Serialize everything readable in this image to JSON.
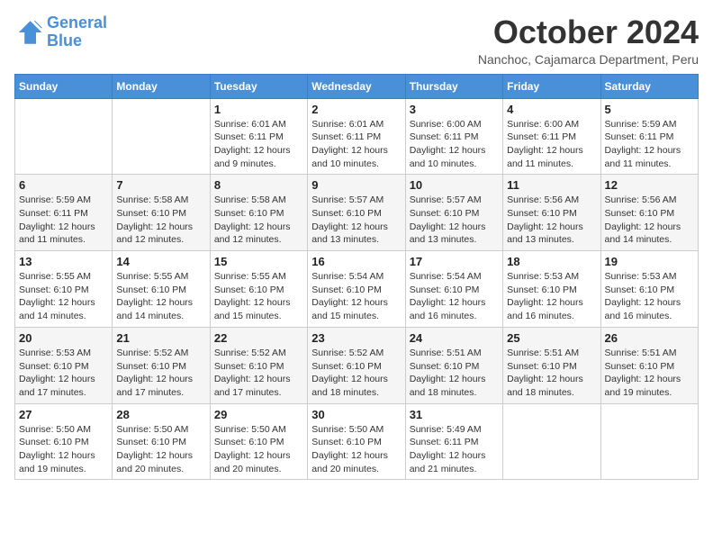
{
  "header": {
    "logo_line1": "General",
    "logo_line2": "Blue",
    "month_title": "October 2024",
    "subtitle": "Nanchoc, Cajamarca Department, Peru"
  },
  "days_of_week": [
    "Sunday",
    "Monday",
    "Tuesday",
    "Wednesday",
    "Thursday",
    "Friday",
    "Saturday"
  ],
  "weeks": [
    [
      {
        "day": "",
        "info": ""
      },
      {
        "day": "",
        "info": ""
      },
      {
        "day": "1",
        "info": "Sunrise: 6:01 AM\nSunset: 6:11 PM\nDaylight: 12 hours and 9 minutes."
      },
      {
        "day": "2",
        "info": "Sunrise: 6:01 AM\nSunset: 6:11 PM\nDaylight: 12 hours and 10 minutes."
      },
      {
        "day": "3",
        "info": "Sunrise: 6:00 AM\nSunset: 6:11 PM\nDaylight: 12 hours and 10 minutes."
      },
      {
        "day": "4",
        "info": "Sunrise: 6:00 AM\nSunset: 6:11 PM\nDaylight: 12 hours and 11 minutes."
      },
      {
        "day": "5",
        "info": "Sunrise: 5:59 AM\nSunset: 6:11 PM\nDaylight: 12 hours and 11 minutes."
      }
    ],
    [
      {
        "day": "6",
        "info": "Sunrise: 5:59 AM\nSunset: 6:11 PM\nDaylight: 12 hours and 11 minutes."
      },
      {
        "day": "7",
        "info": "Sunrise: 5:58 AM\nSunset: 6:10 PM\nDaylight: 12 hours and 12 minutes."
      },
      {
        "day": "8",
        "info": "Sunrise: 5:58 AM\nSunset: 6:10 PM\nDaylight: 12 hours and 12 minutes."
      },
      {
        "day": "9",
        "info": "Sunrise: 5:57 AM\nSunset: 6:10 PM\nDaylight: 12 hours and 13 minutes."
      },
      {
        "day": "10",
        "info": "Sunrise: 5:57 AM\nSunset: 6:10 PM\nDaylight: 12 hours and 13 minutes."
      },
      {
        "day": "11",
        "info": "Sunrise: 5:56 AM\nSunset: 6:10 PM\nDaylight: 12 hours and 13 minutes."
      },
      {
        "day": "12",
        "info": "Sunrise: 5:56 AM\nSunset: 6:10 PM\nDaylight: 12 hours and 14 minutes."
      }
    ],
    [
      {
        "day": "13",
        "info": "Sunrise: 5:55 AM\nSunset: 6:10 PM\nDaylight: 12 hours and 14 minutes."
      },
      {
        "day": "14",
        "info": "Sunrise: 5:55 AM\nSunset: 6:10 PM\nDaylight: 12 hours and 14 minutes."
      },
      {
        "day": "15",
        "info": "Sunrise: 5:55 AM\nSunset: 6:10 PM\nDaylight: 12 hours and 15 minutes."
      },
      {
        "day": "16",
        "info": "Sunrise: 5:54 AM\nSunset: 6:10 PM\nDaylight: 12 hours and 15 minutes."
      },
      {
        "day": "17",
        "info": "Sunrise: 5:54 AM\nSunset: 6:10 PM\nDaylight: 12 hours and 16 minutes."
      },
      {
        "day": "18",
        "info": "Sunrise: 5:53 AM\nSunset: 6:10 PM\nDaylight: 12 hours and 16 minutes."
      },
      {
        "day": "19",
        "info": "Sunrise: 5:53 AM\nSunset: 6:10 PM\nDaylight: 12 hours and 16 minutes."
      }
    ],
    [
      {
        "day": "20",
        "info": "Sunrise: 5:53 AM\nSunset: 6:10 PM\nDaylight: 12 hours and 17 minutes."
      },
      {
        "day": "21",
        "info": "Sunrise: 5:52 AM\nSunset: 6:10 PM\nDaylight: 12 hours and 17 minutes."
      },
      {
        "day": "22",
        "info": "Sunrise: 5:52 AM\nSunset: 6:10 PM\nDaylight: 12 hours and 17 minutes."
      },
      {
        "day": "23",
        "info": "Sunrise: 5:52 AM\nSunset: 6:10 PM\nDaylight: 12 hours and 18 minutes."
      },
      {
        "day": "24",
        "info": "Sunrise: 5:51 AM\nSunset: 6:10 PM\nDaylight: 12 hours and 18 minutes."
      },
      {
        "day": "25",
        "info": "Sunrise: 5:51 AM\nSunset: 6:10 PM\nDaylight: 12 hours and 18 minutes."
      },
      {
        "day": "26",
        "info": "Sunrise: 5:51 AM\nSunset: 6:10 PM\nDaylight: 12 hours and 19 minutes."
      }
    ],
    [
      {
        "day": "27",
        "info": "Sunrise: 5:50 AM\nSunset: 6:10 PM\nDaylight: 12 hours and 19 minutes."
      },
      {
        "day": "28",
        "info": "Sunrise: 5:50 AM\nSunset: 6:10 PM\nDaylight: 12 hours and 20 minutes."
      },
      {
        "day": "29",
        "info": "Sunrise: 5:50 AM\nSunset: 6:10 PM\nDaylight: 12 hours and 20 minutes."
      },
      {
        "day": "30",
        "info": "Sunrise: 5:50 AM\nSunset: 6:10 PM\nDaylight: 12 hours and 20 minutes."
      },
      {
        "day": "31",
        "info": "Sunrise: 5:49 AM\nSunset: 6:11 PM\nDaylight: 12 hours and 21 minutes."
      },
      {
        "day": "",
        "info": ""
      },
      {
        "day": "",
        "info": ""
      }
    ]
  ]
}
